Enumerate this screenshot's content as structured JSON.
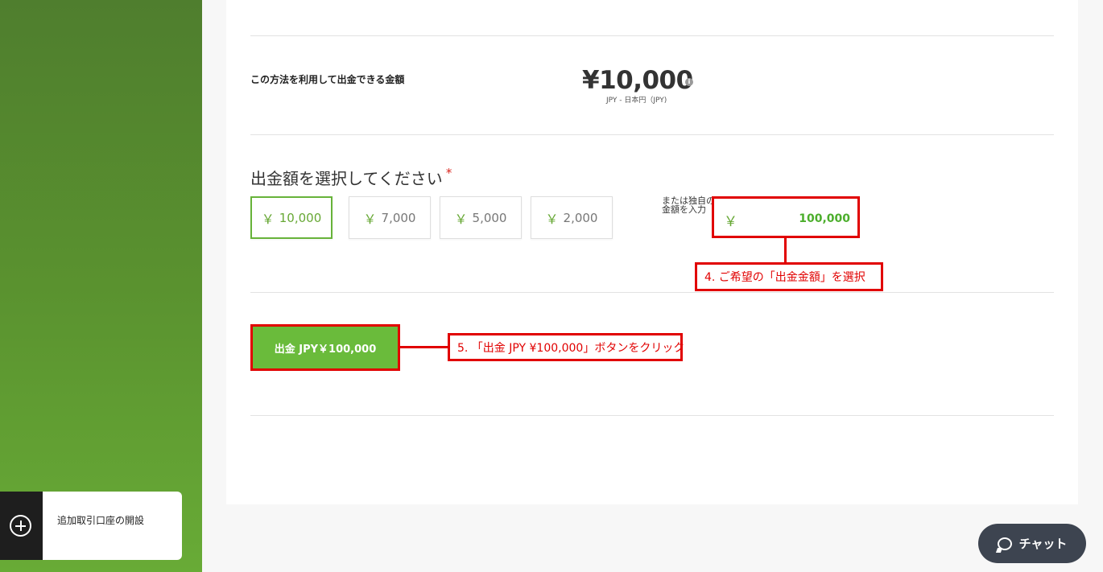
{
  "sidebar": {
    "add_account_label": "追加取引口座の開設"
  },
  "withdraw": {
    "available_label": "この方法を利用して出金できる金額",
    "available_amount": "¥10,000",
    "info_icon": "i",
    "available_currency": "JPY - 日本円（JPY)",
    "select_title": "出金額を選択してください",
    "required_mark": "*",
    "currency_symbol": "￥",
    "preset_amounts": [
      "10,000",
      "7,000",
      "5,000",
      "2,000"
    ],
    "selected_preset": "10,000",
    "or_text": "または独自の金額を入力",
    "custom_amount_value": "100,000",
    "submit_label": "出金 JPY￥100,000"
  },
  "annotations": {
    "step4": "4. ご希望の「出金金額」を選択",
    "step5": "5. 「出金 JPY ¥100,000」ボタンをクリック",
    "color": "#e10000"
  },
  "chat": {
    "label": "チャット"
  },
  "colors": {
    "brand_green": "#6abb3b",
    "sidebar_green": "#5a922f",
    "chat_bg": "#3d4450"
  }
}
